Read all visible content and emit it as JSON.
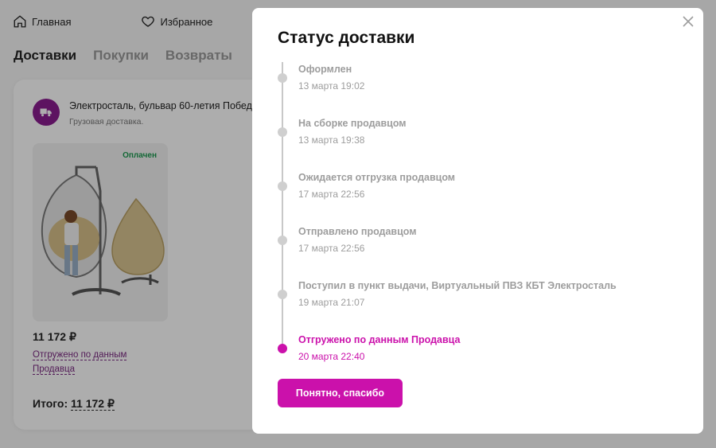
{
  "nav": {
    "home_label": "Главная",
    "favorites_label": "Избранное"
  },
  "tabs": [
    {
      "label": "Доставки"
    },
    {
      "label": "Покупки"
    },
    {
      "label": "Возвраты"
    }
  ],
  "delivery": {
    "address": "Электросталь, бульвар 60-летия Победы",
    "type": "Грузовая доставка.",
    "paid_badge": "Оплачен",
    "price": "11 172 ₽",
    "status": "Отгружено по данным Продавца",
    "total_label": "Итого:",
    "total_amount": "11 172 ₽"
  },
  "modal": {
    "title": "Статус доставки",
    "steps": [
      {
        "title": "Оформлен",
        "date": "13 марта 19:02"
      },
      {
        "title": "На сборке продавцом",
        "date": "13 марта 19:38"
      },
      {
        "title": "Ожидается отгрузка продавцом",
        "date": "17 марта 22:56"
      },
      {
        "title": "Отправлено продавцом",
        "date": "17 марта 22:56"
      },
      {
        "title": "Поступил в пункт выдачи, Виртуальный ПВЗ КБТ Электросталь",
        "date": "19 марта 21:07"
      },
      {
        "title": "Отгружено по данным Продавца",
        "date": "20 марта 22:40"
      }
    ],
    "confirm_label": "Понятно, спасибо"
  },
  "colors": {
    "accent": "#cb11ab",
    "inactive": "#9d9d9d",
    "paid": "#1d9a50"
  }
}
